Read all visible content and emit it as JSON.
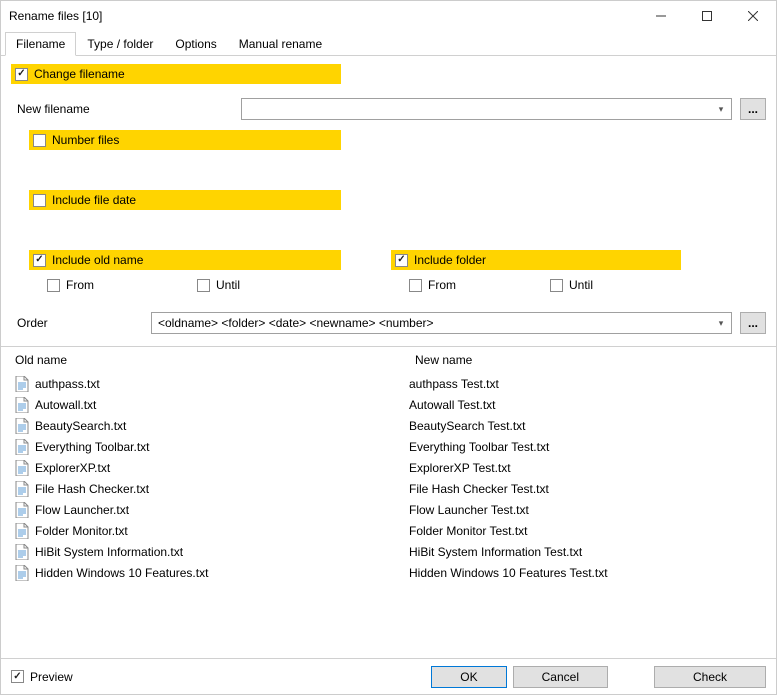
{
  "title": "Rename files [10]",
  "tabs": [
    "Filename",
    "Type / folder",
    "Options",
    "Manual rename"
  ],
  "options": {
    "change_filename": "Change filename",
    "new_filename_label": "New filename",
    "number_files": "Number files",
    "include_file_date": "Include file date",
    "include_old_name": "Include old name",
    "include_folder": "Include folder",
    "from": "From",
    "until": "Until",
    "order_label": "Order",
    "order_value": "<oldname> <folder> <date> <newname> <number>",
    "dots": "..."
  },
  "headers": {
    "old": "Old name",
    "new": "New name"
  },
  "files": [
    {
      "old": "authpass.txt",
      "new": "authpass Test.txt"
    },
    {
      "old": "Autowall.txt",
      "new": "Autowall Test.txt"
    },
    {
      "old": "BeautySearch.txt",
      "new": "BeautySearch Test.txt"
    },
    {
      "old": "Everything Toolbar.txt",
      "new": "Everything Toolbar Test.txt"
    },
    {
      "old": "ExplorerXP.txt",
      "new": "ExplorerXP Test.txt"
    },
    {
      "old": "File Hash Checker.txt",
      "new": "File Hash Checker Test.txt"
    },
    {
      "old": "Flow Launcher.txt",
      "new": "Flow Launcher Test.txt"
    },
    {
      "old": "Folder Monitor.txt",
      "new": "Folder Monitor Test.txt"
    },
    {
      "old": "HiBit System Information.txt",
      "new": "HiBit System Information Test.txt"
    },
    {
      "old": "Hidden Windows 10 Features.txt",
      "new": "Hidden Windows 10 Features Test.txt"
    }
  ],
  "footer": {
    "preview": "Preview",
    "ok": "OK",
    "cancel": "Cancel",
    "check": "Check"
  }
}
